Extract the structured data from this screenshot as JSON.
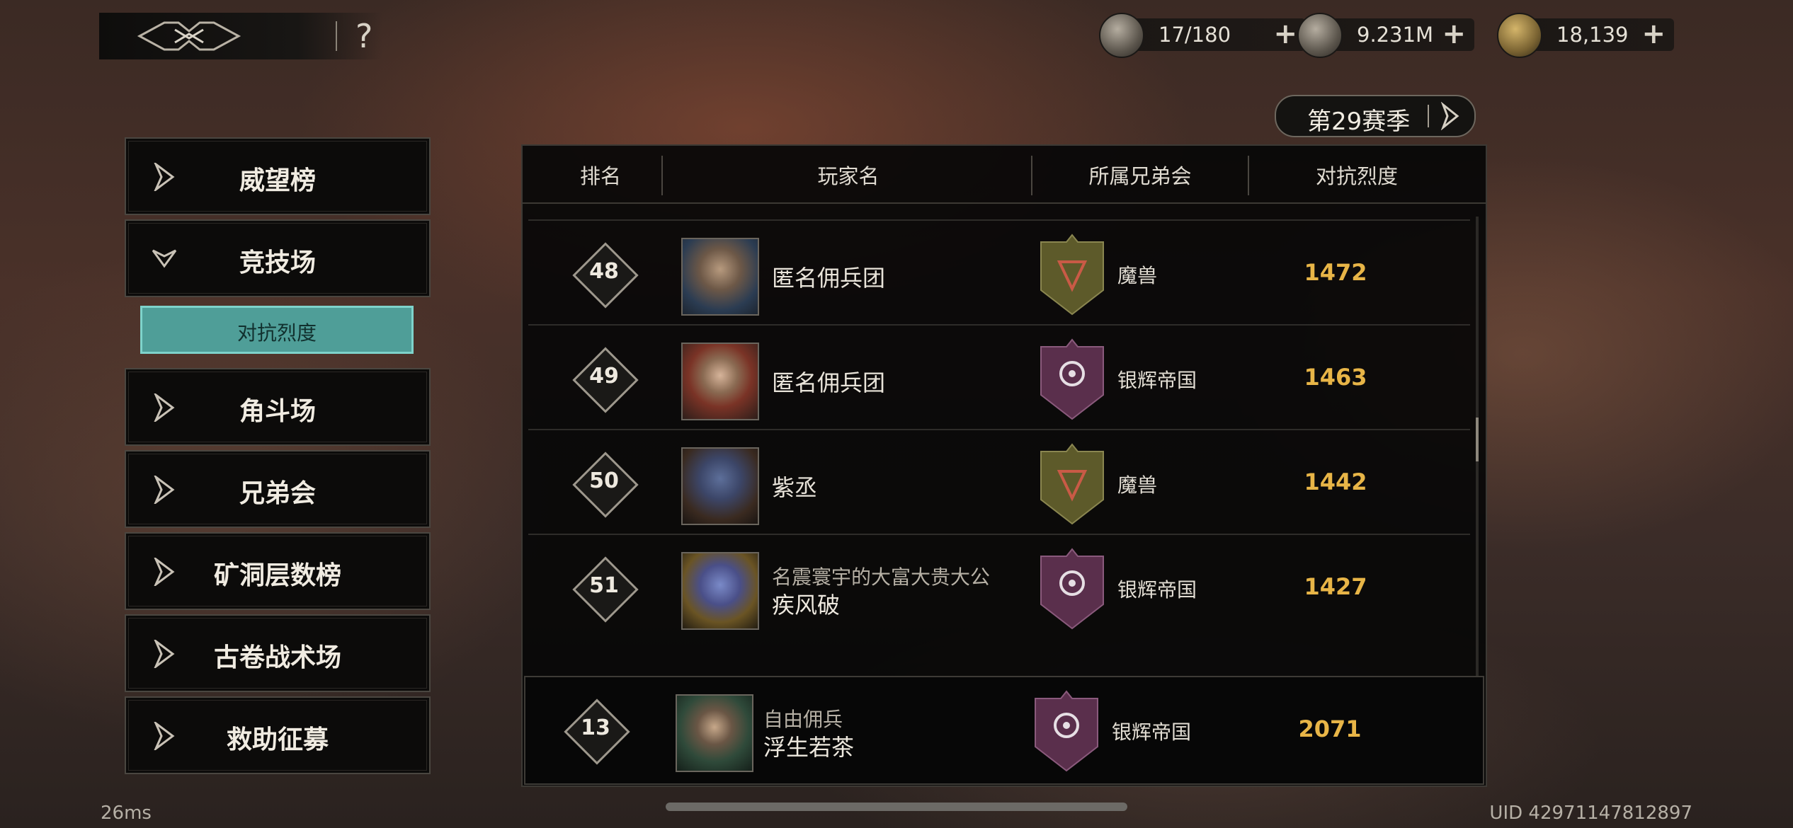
{
  "header": {
    "help_label": "?",
    "currencies": [
      {
        "icon": "stamina-icon",
        "value": "17/180"
      },
      {
        "icon": "silver-coin-icon",
        "value": "9.231M"
      },
      {
        "icon": "gold-coin-icon",
        "value": "18,139"
      }
    ],
    "plus_label": "+"
  },
  "season": {
    "label": "第29赛季"
  },
  "sidebar": {
    "items": [
      {
        "label": "威望榜"
      },
      {
        "label": "竞技场"
      },
      {
        "label": "角斗场"
      },
      {
        "label": "兄弟会"
      },
      {
        "label": "矿洞层数榜"
      },
      {
        "label": "古卷战术场"
      },
      {
        "label": "救助征募"
      }
    ],
    "active_sub": "对抗烈度"
  },
  "table": {
    "headers": [
      "排名",
      "玩家名",
      "所属兄弟会",
      "对抗烈度"
    ],
    "rows": [
      {
        "rank": "48",
        "title": "",
        "name": "匿名佣兵团",
        "guild": "魔兽",
        "guild_color": "#5d5a2a",
        "score": "1472"
      },
      {
        "rank": "49",
        "title": "",
        "name": "匿名佣兵团",
        "guild": "银辉帝国",
        "guild_color": "#5a2f4c",
        "score": "1463"
      },
      {
        "rank": "50",
        "title": "",
        "name": "紫丞",
        "guild": "魔兽",
        "guild_color": "#5d5a2a",
        "score": "1442"
      },
      {
        "rank": "51",
        "title": "名震寰宇的大富大贵大公",
        "name": "疾风破",
        "guild": "银辉帝国",
        "guild_color": "#5a2f4c",
        "score": "1427"
      }
    ],
    "my_row": {
      "rank": "13",
      "title": "自由佣兵",
      "name": "浮生若茶",
      "guild": "银辉帝国",
      "guild_color": "#5a2f4c",
      "score": "2071"
    }
  },
  "footer": {
    "latency": "26ms",
    "uid": "UID 42971147812897"
  },
  "colors": {
    "accent_teal": "#4f9e98",
    "score_gold": "#e8b547"
  }
}
